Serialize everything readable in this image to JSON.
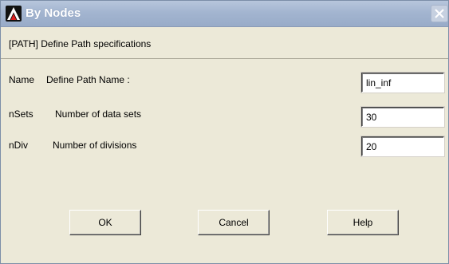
{
  "window": {
    "title": "By Nodes"
  },
  "header": {
    "text": "[PATH]  Define Path specifications"
  },
  "fields": [
    {
      "key": "Name",
      "description": "Define Path Name :",
      "value": "lin_inf"
    },
    {
      "key": "nSets",
      "description": "Number of data sets",
      "value": "30"
    },
    {
      "key": "nDiv",
      "description": "Number of divisions",
      "value": "20"
    }
  ],
  "buttons": {
    "ok": "OK",
    "cancel": "Cancel",
    "help": "Help"
  },
  "icons": {
    "app": "ansys-logo-icon",
    "close": "close-icon"
  },
  "colors": {
    "titlebar": "#a3b5d0",
    "dialog_bg": "#ece9d8"
  }
}
